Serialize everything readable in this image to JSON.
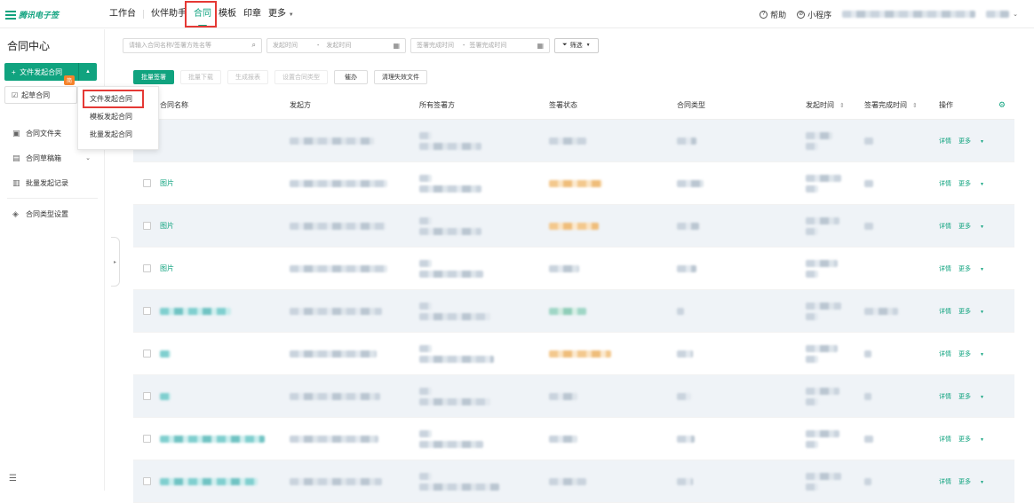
{
  "brand": {
    "name": "腾讯电子签"
  },
  "nav": {
    "items": [
      "工作台",
      "伙伴助手",
      "合同",
      "模板",
      "印章",
      "更多"
    ],
    "active_index": 2
  },
  "top_right": {
    "help": "帮助",
    "mini_program": "小程序"
  },
  "sidebar": {
    "title": "合同中心",
    "primary_button": "文件发起合同",
    "draft_button": "起草合同",
    "badge": "简",
    "menu": [
      {
        "label": "合同文件夹",
        "icon": "folder-icon"
      },
      {
        "label": "合同草稿箱",
        "icon": "draft-box-icon",
        "has_chevron": true
      },
      {
        "label": "批量发起记录",
        "icon": "batch-record-icon"
      },
      {
        "label": "合同类型设置",
        "icon": "layers-icon"
      }
    ]
  },
  "dropdown": {
    "items": [
      "文件发起合同",
      "模板发起合同",
      "批量发起合同"
    ]
  },
  "filters": {
    "search_placeholder": "请输入合同名称/签署方姓名等",
    "start_from": "发起时间",
    "start_to": "发起时间",
    "done_from": "签署完成时间",
    "done_to": "签署完成时间",
    "range_sep": "-",
    "filter_button": "筛选"
  },
  "actions": [
    "批量签署",
    "批量下载",
    "生成报表",
    "设置合同类型",
    "催办",
    "清理失效文件"
  ],
  "table": {
    "headers": {
      "name": "合同名称",
      "initiator": "发起方",
      "signers": "所有签署方",
      "status": "签署状态",
      "type": "合同类型",
      "start": "发起时间",
      "done": "签署完成时间",
      "ops": "操作"
    },
    "rows": [
      {
        "name": ""
      },
      {
        "name": "图片"
      },
      {
        "name": "图片"
      },
      {
        "name": "图片"
      },
      {
        "name": ""
      },
      {
        "name": ""
      },
      {
        "name": ""
      },
      {
        "name": ""
      },
      {
        "name": ""
      }
    ],
    "op_detail": "详情",
    "op_more": "更多"
  }
}
